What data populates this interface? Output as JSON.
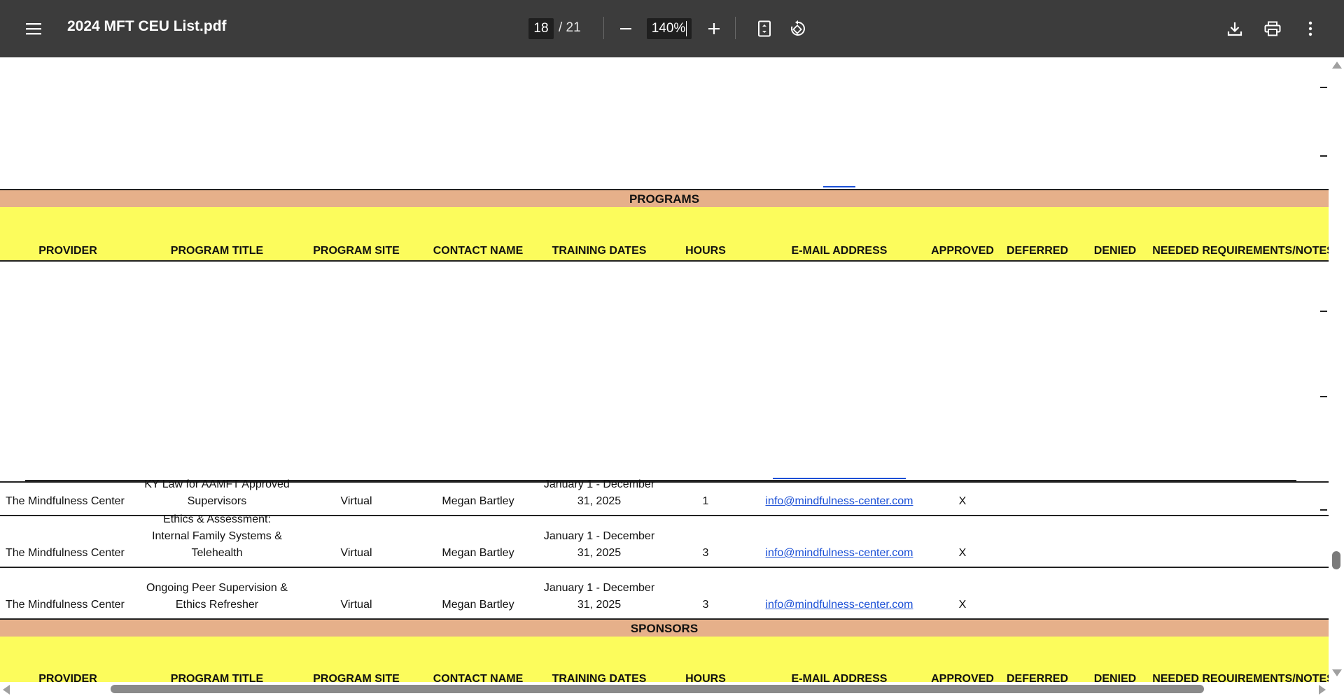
{
  "toolbar": {
    "title": "2024 MFT CEU List.pdf",
    "page_current": "18",
    "page_total": "/ 21",
    "zoom": "140%"
  },
  "programs": {
    "band_label": "PROGRAMS",
    "headers": [
      "PROVIDER",
      "PROGRAM TITLE",
      "PROGRAM SITE",
      "CONTACT NAME",
      "TRAINING DATES",
      "HOURS",
      "E-MAIL ADDRESS",
      "APPROVED",
      "DEFERRED",
      "DENIED",
      "NEEDED REQUIREMENTS/NOTES"
    ]
  },
  "rows": [
    {
      "provider": "The Mindfulness Center",
      "title_lines": [
        "KY Law for AAMFT Approved",
        "Supervisors"
      ],
      "site": "Virtual",
      "contact": "Megan Bartley",
      "dates_lines": [
        "January 1 - December",
        "31, 2025"
      ],
      "hours": "1",
      "email": "info@mindfulness-center.com",
      "approved": "X"
    },
    {
      "provider": "The Mindfulness Center",
      "title_lines": [
        "Ethics & Assessment:",
        "Internal Family Systems &",
        "Telehealth"
      ],
      "site": "Virtual",
      "contact": "Megan Bartley",
      "dates_lines": [
        "January 1 - December",
        "31, 2025"
      ],
      "hours": "3",
      "email": "info@mindfulness-center.com",
      "approved": "X"
    },
    {
      "provider": "The Mindfulness Center",
      "title_lines": [
        "Ongoing Peer Supervision &",
        "Ethics Refresher"
      ],
      "site": "Virtual",
      "contact": "Megan Bartley",
      "dates_lines": [
        "January 1 - December",
        "31, 2025"
      ],
      "hours": "3",
      "email": "info@mindfulness-center.com",
      "approved": "X"
    }
  ],
  "sponsors": {
    "band_label": "SPONSORS",
    "headers": [
      "PROVIDER",
      "PROGRAM TITLE",
      "PROGRAM SITE",
      "CONTACT NAME",
      "TRAINING DATES",
      "HOURS",
      "E-MAIL ADDRESS",
      "APPROVED",
      "DEFERRED",
      "DENIED",
      "NEEDED REQUIREMENTS/NOTES"
    ]
  },
  "colors": {
    "toolbar_bg": "#3c3c3c",
    "band_orange": "#e6b08a",
    "header_yellow": "#fcfc5c",
    "link_blue": "#1a4fd6"
  },
  "icons": {
    "menu": "hamburger-menu-icon",
    "zoom_out": "minus-icon",
    "zoom_in": "plus-icon",
    "fit": "fit-page-icon",
    "rotate": "rotate-icon",
    "download": "download-icon",
    "print": "print-icon",
    "more": "more-vertical-icon"
  }
}
